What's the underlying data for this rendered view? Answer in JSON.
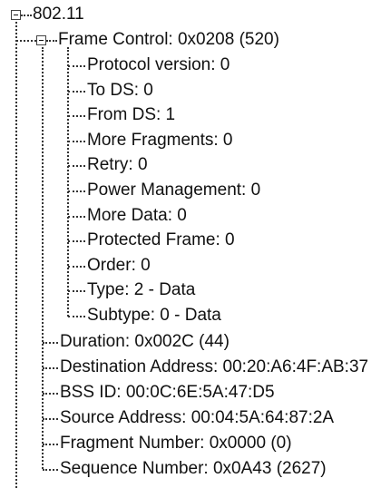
{
  "tree": {
    "root": {
      "label": "802.11",
      "expanded": true,
      "children_frame_control": {
        "label": "Frame Control: 0x0208 (520)",
        "expanded": true,
        "fields": [
          "Protocol version: 0",
          "To DS: 0",
          "From DS: 1",
          "More Fragments: 0",
          "Retry: 0",
          "Power Management: 0",
          "More Data: 0",
          "Protected Frame: 0",
          "Order: 0",
          "Type: 2 - Data",
          "Subtype: 0 - Data"
        ]
      },
      "fields": [
        "Duration: 0x002C (44)",
        "Destination Address: 00:20:A6:4F:AB:37",
        "BSS ID: 00:0C:6E:5A:47:D5",
        "Source Address: 00:04:5A:64:87:2A",
        "Fragment Number: 0x0000 (0)",
        "Sequence Number: 0x0A43 (2627)"
      ]
    }
  }
}
